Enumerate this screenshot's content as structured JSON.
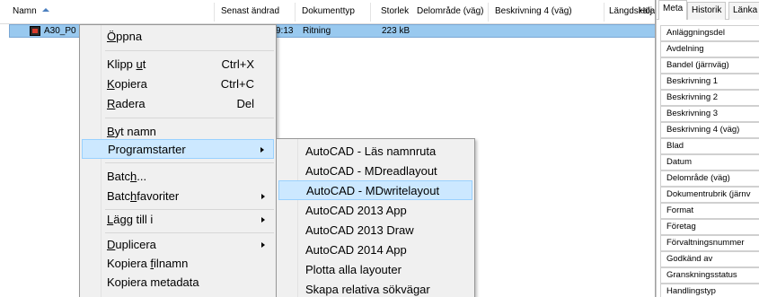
{
  "list": {
    "columns": [
      {
        "label": "Namn"
      },
      {
        "label": "Senast ändrad"
      },
      {
        "label": "Dokumenttyp"
      },
      {
        "label": "Storlek"
      },
      {
        "label": "Delområde (väg)"
      },
      {
        "label": "Beskrivning 4 (väg)"
      },
      {
        "label": "Längdskala"
      },
      {
        "label": "Höj"
      }
    ],
    "row": {
      "name": "A30_P0",
      "modified": "9:13",
      "doctype": "Ritning",
      "size": "223 kB"
    }
  },
  "menu": {
    "items": [
      {
        "pre": "",
        "u": "Ö",
        "post": "ppna",
        "shortcut": ""
      },
      {
        "pre": "Klipp ",
        "u": "u",
        "post": "t",
        "shortcut": "Ctrl+X"
      },
      {
        "pre": "",
        "u": "K",
        "post": "opiera",
        "shortcut": "Ctrl+C"
      },
      {
        "pre": "",
        "u": "R",
        "post": "adera",
        "shortcut": "Del"
      },
      {
        "pre": "",
        "u": "B",
        "post": "yt namn",
        "shortcut": ""
      },
      {
        "pre": "Programstarter",
        "u": "",
        "post": "",
        "shortcut": ""
      },
      {
        "pre": "Batc",
        "u": "h",
        "post": "...",
        "shortcut": ""
      },
      {
        "pre": "Batc",
        "u": "h",
        "post": "favoriter",
        "shortcut": ""
      },
      {
        "pre": "",
        "u": "L",
        "post": "ägg till i",
        "shortcut": ""
      },
      {
        "pre": "",
        "u": "D",
        "post": "uplicera",
        "shortcut": ""
      },
      {
        "pre": "Kopiera ",
        "u": "f",
        "post": "ilnamn",
        "shortcut": ""
      },
      {
        "pre": "Kopiera metadata",
        "u": "",
        "post": "",
        "shortcut": ""
      }
    ]
  },
  "submenu": {
    "items": [
      {
        "label": "AutoCAD - Läs namnruta"
      },
      {
        "label": "AutoCAD - MDreadlayout"
      },
      {
        "label": "AutoCAD - MDwritelayout"
      },
      {
        "label": "AutoCAD 2013 App"
      },
      {
        "label": "AutoCAD 2013 Draw"
      },
      {
        "label": "AutoCAD 2014 App"
      },
      {
        "label": "Plotta alla layouter"
      },
      {
        "label": "Skapa relativa sökvägar"
      }
    ]
  },
  "panel": {
    "tabs": [
      {
        "label": "Meta"
      },
      {
        "label": "Historik"
      },
      {
        "label": "Länka"
      }
    ],
    "properties": [
      {
        "label": "Anläggningsdel"
      },
      {
        "label": "Avdelning"
      },
      {
        "label": "Bandel (järnväg)"
      },
      {
        "label": "Beskrivning 1"
      },
      {
        "label": "Beskrivning 2"
      },
      {
        "label": "Beskrivning 3"
      },
      {
        "label": "Beskrivning 4 (väg)"
      },
      {
        "label": "Blad"
      },
      {
        "label": "Datum"
      },
      {
        "label": "Delområde (väg)"
      },
      {
        "label": "Dokumentrubrik (järnv"
      },
      {
        "label": "Format"
      },
      {
        "label": "Företag"
      },
      {
        "label": "Förvaltningsnummer"
      },
      {
        "label": "Godkänd av"
      },
      {
        "label": "Granskningsstatus"
      },
      {
        "label": "Handlingstyp"
      }
    ]
  },
  "colors": {
    "selection": "#99c9ef",
    "menu_highlight": "#cce8ff",
    "menu_bg": "#f0f0f0"
  }
}
